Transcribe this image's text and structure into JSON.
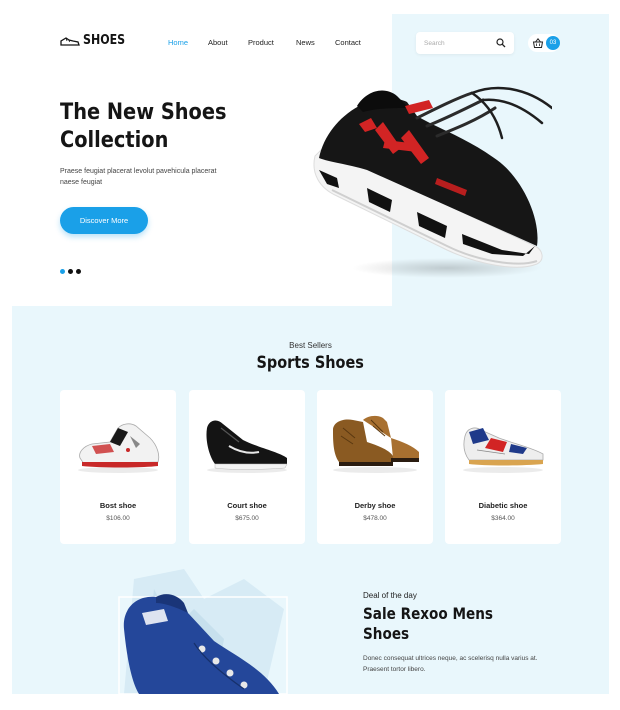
{
  "header": {
    "logo_text": "SHOES",
    "nav": [
      {
        "label": "Home",
        "active": true
      },
      {
        "label": "About",
        "active": false
      },
      {
        "label": "Product",
        "active": false
      },
      {
        "label": "News",
        "active": false
      },
      {
        "label": "Contact",
        "active": false
      }
    ],
    "search_placeholder": "Search",
    "cart_count": "03"
  },
  "hero": {
    "title": "The New Shoes Collection",
    "description": "Praese feugiat placerat levolut pavehicula placerat naese feugiat",
    "button_label": "Discover More",
    "slides": 3,
    "active_slide": 1
  },
  "best_sellers": {
    "subtitle": "Best Sellers",
    "title": "Sports Shoes",
    "products": [
      {
        "name": "Bost shoe",
        "price": "$106.00",
        "icon": "sneaker-white-red"
      },
      {
        "name": "Court shoe",
        "price": "$675.00",
        "icon": "sneaker-black"
      },
      {
        "name": "Derby shoe",
        "price": "$478.00",
        "icon": "boots-brown"
      },
      {
        "name": "Diabetic shoe",
        "price": "$364.00",
        "icon": "sneaker-blue-red"
      }
    ]
  },
  "deal": {
    "subtitle": "Deal of the day",
    "title": "Sale Rexoo Mens Shoes",
    "description": "Donec consequat ultrices neque, ac scelerisq nulla varius at. Praesent tortor libero."
  },
  "colors": {
    "accent": "#1aa0e8",
    "background": "#e9f7fc",
    "text": "#151515"
  }
}
